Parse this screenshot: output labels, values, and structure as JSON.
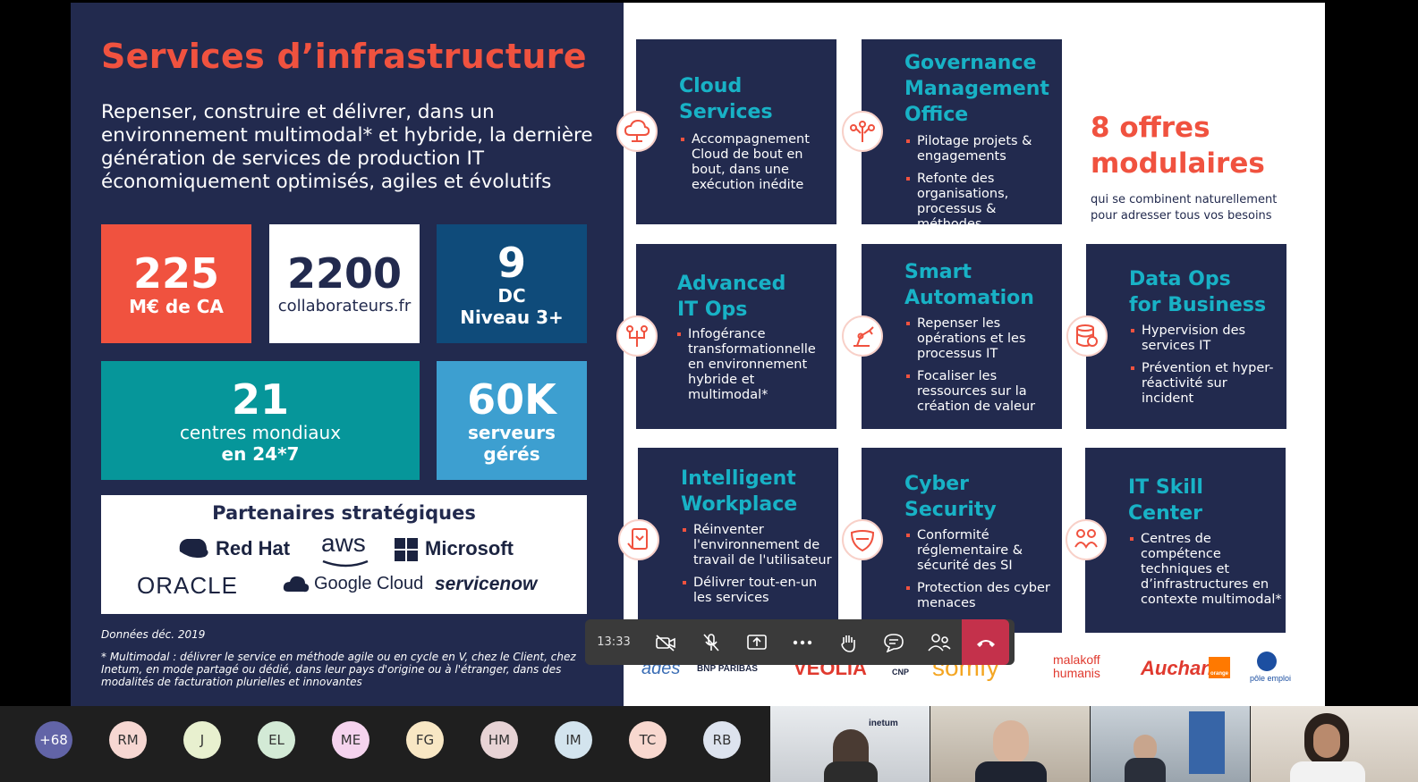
{
  "slide": {
    "title": "Services d’infrastructure",
    "subtitle": "Repenser, construire et délivrer, dans un environnement multimodal* et hybride, la dernière génération de services de production IT économiquement optimisés, agiles et évolutifs",
    "kpis": {
      "ca": {
        "value": "225",
        "label": "M€ de CA"
      },
      "collab": {
        "value": "2200",
        "label": "collaborateurs.fr"
      },
      "dc": {
        "value": "9",
        "label1": "DC",
        "label2": "Niveau 3+"
      },
      "centres": {
        "value": "21",
        "label1": "centres mondiaux",
        "label2": "en 24*7"
      },
      "servers": {
        "value": "60K",
        "label1": "serveurs",
        "label2": "gérés"
      }
    },
    "partners": {
      "title": "Partenaires stratégiques",
      "logos": [
        "Red Hat",
        "aws",
        "Microsoft",
        "ORACLE",
        "Google Cloud",
        "servicenow"
      ]
    },
    "footnote_date": "Données déc. 2019",
    "footnote": "* Multimodal : délivrer le service en méthode agile ou en cycle en V, chez le Client, chez Inetum, en mode partagé ou dédié, dans leur pays d'origine ou à l'étranger, dans des modalités de facturation plurielles et innovantes",
    "offres": {
      "headline1": "8 offres",
      "headline2": "modulaires",
      "text": "qui se combinent naturellement pour adresser tous vos besoins"
    },
    "cards": [
      {
        "t1": "Cloud",
        "t2": "Services",
        "items": [
          "Accompagnement Cloud de bout en bout, dans une exécution inédite"
        ],
        "icon": "cloud-icon"
      },
      {
        "t1": "Governance",
        "t2": "Management",
        "t3": "Office",
        "items": [
          "Pilotage projets & engagements",
          "Refonte des organisations, processus & méthodes"
        ],
        "icon": "network-hand-icon"
      },
      {
        "t1": "Advanced",
        "t2": "IT Ops",
        "items": [
          "Infogérance transformationnelle en environnement hybride et multimodal*"
        ],
        "icon": "nodes-hand-icon"
      },
      {
        "t1": "Smart",
        "t2": "Automation",
        "items": [
          "Repenser les opérations et les processus IT",
          "Focaliser les ressources sur la création de valeur"
        ],
        "icon": "robot-arm-icon"
      },
      {
        "t1": "Data Ops",
        "t2": "for Business",
        "items": [
          "Hypervision des services IT",
          "Prévention et hyper-réactivité sur incident"
        ],
        "icon": "database-icon"
      },
      {
        "t1": "Intelligent",
        "t2": "Workplace",
        "items": [
          "Réinventer l'environnement de travail de l'utilisateur",
          "Délivrer tout-en-un les services"
        ],
        "icon": "tablet-hand-icon"
      },
      {
        "t1": "Cyber",
        "t2": "Security",
        "items": [
          "Conformité réglementaire & sécurité des SI",
          "Protection des cyber menaces"
        ],
        "icon": "shield-icon"
      },
      {
        "t1": "IT Skill",
        "t2": "Center",
        "items": [
          "Centres de compétence techniques et d’infrastructures en contexte multimodal*"
        ],
        "icon": "people-icon"
      }
    ],
    "clients": [
      "ades",
      "BNP PARIBAS",
      "VEOLIA",
      "CNP",
      "somfy",
      "malakoff humanis",
      "Auchan",
      "orange",
      "pôle emploi"
    ]
  },
  "meeting": {
    "time": "13:33",
    "controls": [
      "camera-off-icon",
      "mic-off-icon",
      "share-icon",
      "more-icon",
      "raise-hand-icon",
      "chat-icon",
      "participants-icon",
      "hang-up-icon"
    ],
    "more_count": "+68",
    "participants": [
      {
        "initials": "RM",
        "color": "#f6d7d2"
      },
      {
        "initials": "J",
        "color": "#e8f0cf"
      },
      {
        "initials": "EL",
        "color": "#d3ead6"
      },
      {
        "initials": "ME",
        "color": "#f5d3ee"
      },
      {
        "initials": "FG",
        "color": "#f8e7c4"
      },
      {
        "initials": "HM",
        "color": "#e7d3d5"
      },
      {
        "initials": "IM",
        "color": "#d3e4ee"
      },
      {
        "initials": "TC",
        "color": "#f8d8cf"
      },
      {
        "initials": "RB",
        "color": "#dde3ee"
      }
    ],
    "more_color": "#6264a7",
    "video_banner": "inetum"
  }
}
